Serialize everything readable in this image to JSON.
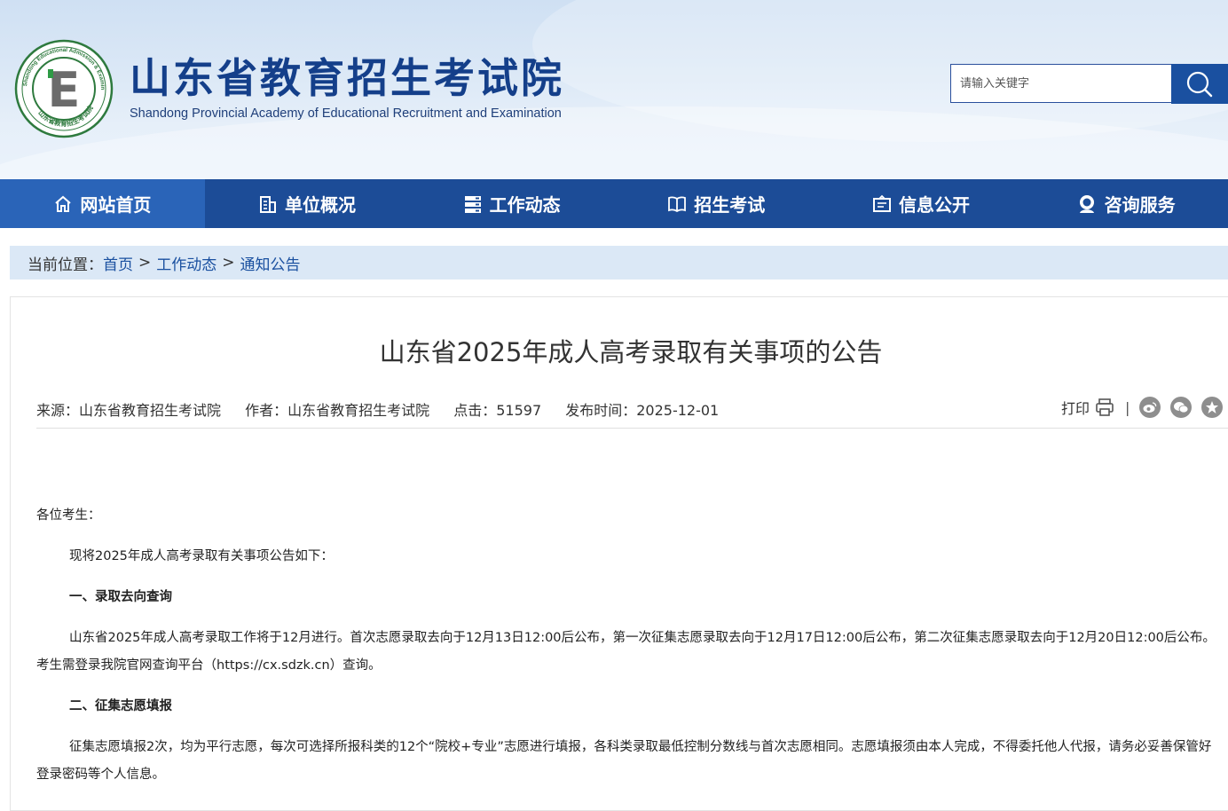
{
  "header": {
    "title": "山东省教育招生考试院",
    "subtitle": "Shandong Provincial Academy of Educational Recruitment and Examination",
    "seal_text_top": "Shandong Educational Admission & Examination",
    "seal_text_bottom": "山东省教育招生考试院",
    "seal_letter": "E",
    "search_placeholder": "请输入关键字"
  },
  "nav": {
    "items": [
      {
        "label": "网站首页",
        "icon": "home-icon"
      },
      {
        "label": "单位概况",
        "icon": "building-icon"
      },
      {
        "label": "工作动态",
        "icon": "server-icon"
      },
      {
        "label": "招生考试",
        "icon": "book-icon"
      },
      {
        "label": "信息公开",
        "icon": "info-card-icon"
      },
      {
        "label": "咨询服务",
        "icon": "support-icon"
      }
    ]
  },
  "breadcrumb": {
    "lead": "当前位置：",
    "items": [
      "首页",
      "工作动态",
      "通知公告"
    ],
    "separator": ">"
  },
  "article": {
    "title": "山东省2025年成人高考录取有关事项的公告",
    "meta": {
      "source": "来源：山东省教育招生考试院",
      "author": "作者：山东省教育招生考试院",
      "clicks": "点击：51597",
      "date": "发布时间：2025-12-01"
    },
    "print_label": "打印",
    "share_sep": "|",
    "paragraphs": [
      "各位考生：",
      "现将2025年成人高考录取有关事项公告如下：",
      "一、录取去向查询",
      "山东省2025年成人高考录取工作将于12月进行。首次志愿录取去向于12月13日12:00后公布，第一次征集志愿录取去向于12月17日12:00后公布，第二次征集志愿录取去向于12月20日12:00后公布。考生需登录我院官网查询平台（https://cx.sdzk.cn）查询。",
      "二、征集志愿填报",
      "征集志愿填报2次，均为平行志愿，每次可选择所报科类的12个“院校+专业”志愿进行填报，各科类录取最低控制分数线与首次志愿相同。志愿填报须由本人完成，不得委托他人代报，请务必妥善保管好登录密码等个人信息。"
    ]
  },
  "colors": {
    "nav_bg": "#1c4c97",
    "nav_active": "#2a64b8",
    "title_blue": "#143f8a",
    "link_blue": "#1a50a0",
    "crumb_bg": "#dbe8f6"
  }
}
